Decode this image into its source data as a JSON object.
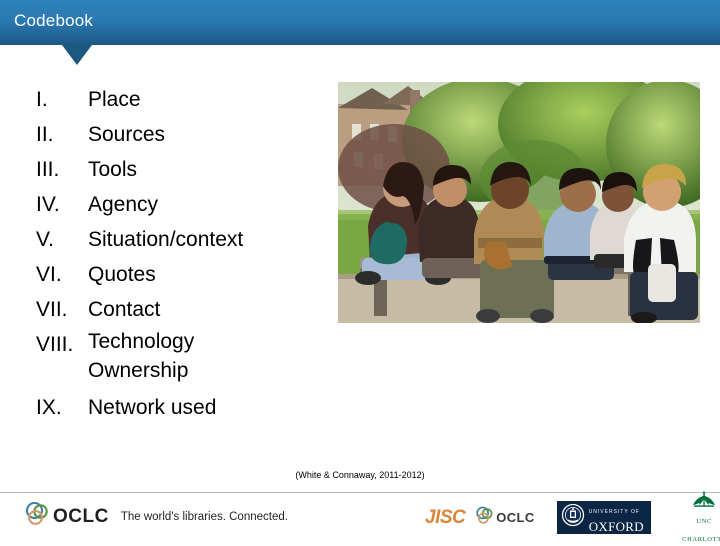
{
  "header": {
    "title": "Codebook",
    "gradient_top": "#2d80ba",
    "gradient_bottom": "#1d587f",
    "notch_color": "#1d5880"
  },
  "content": {
    "items": [
      {
        "numeral": "I.",
        "label": "Place"
      },
      {
        "numeral": "II.",
        "label": "Sources"
      },
      {
        "numeral": "III.",
        "label": "Tools"
      },
      {
        "numeral": "IV.",
        "label": "Agency"
      },
      {
        "numeral": "V.",
        "label": "Situation/context"
      },
      {
        "numeral": "VI.",
        "label": "Quotes"
      },
      {
        "numeral": "VII.",
        "label": "Contact"
      },
      {
        "numeral": "VIII.",
        "label": "Technology Ownership"
      },
      {
        "numeral": "IX.",
        "label": "Network used"
      }
    ]
  },
  "photo": {
    "alt": "Group of young people sitting and talking on a park bench outdoors"
  },
  "citation": "(White & Connaway, 2011-2012)",
  "footer": {
    "oclc_wordmark": "OCLC",
    "oclc_tagline": "The world's libraries. Connected.",
    "partners": {
      "jisc": "JISC",
      "oclc_small": "OCLC",
      "oxford_sub": "UNIVERSITY OF",
      "oxford_main": "OXFORD",
      "unc": "UNC CHARLOTTE"
    },
    "accent_jisc": "#d9863b",
    "accent_oxford": "#0b2545",
    "accent_unc": "#00703c"
  }
}
